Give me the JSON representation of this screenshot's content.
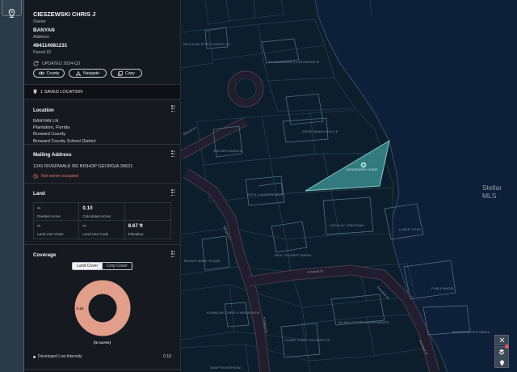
{
  "owner": {
    "name": "CIESZEWSKI CHRIS J",
    "name_label": "Owner"
  },
  "address": {
    "value": "BANYAN",
    "label": "Address"
  },
  "parcel": {
    "id": "494114081231",
    "label": "Parcel ID"
  },
  "updated": "UPDATED 2024-Q3",
  "actions": {
    "county": "County",
    "navigate": "Navigate",
    "copy": "Copy"
  },
  "saved": "1 SAVED LOCATION",
  "location": {
    "title": "Location",
    "lines": [
      "BANYAN LN",
      "Plantation, Florida",
      "Broward County",
      "Broward County School District"
    ]
  },
  "mailing": {
    "title": "Mailing Address",
    "address": "1241 RIVERWALK RD BISHOP GEORGIA 30621",
    "warning": "Not owner occupied"
  },
  "land": {
    "title": "Land",
    "cells": [
      {
        "value": "--",
        "label": "Deeded Acres"
      },
      {
        "value": "0.10",
        "label": "Calculated Acres"
      },
      {
        "value": "",
        "label": ""
      },
      {
        "value": "--",
        "label": "Land Use Class"
      },
      {
        "value": "--",
        "label": "Land Use Code"
      },
      {
        "value": "8.67 ft",
        "label": "Elevation"
      }
    ]
  },
  "coverage": {
    "title": "Coverage",
    "tabs": [
      "Land Cover",
      "Crop Cover"
    ],
    "units": "(in acres)",
    "legend": [
      {
        "name": "Developed Low Intensity",
        "value": "0.10"
      }
    ]
  },
  "chart_data": {
    "type": "pie",
    "labels": [
      "Developed Low Intensity"
    ],
    "values": [
      0.1
    ],
    "data_labels": [
      "0.10"
    ],
    "colors": [
      "#e19e8a"
    ]
  },
  "map": {
    "watermark": "Stellar MLS",
    "parcel_labels": [
      "CELLULAR STRUCTURES LLC",
      "SCHAUMBERG & CATHERINE M",
      "ZIEGELMANN KELLY E",
      "ROCHER ANGELA",
      "CIESZEWSKI CHRIS",
      "SETH J M BORROWER",
      "AZOULAY JONATHAN",
      "LUBER JOHN",
      "BISHOP MADE HJ AND",
      "NEAL TOLBERT MARIA",
      "PUBLE ANGEL",
      "KOWALSKI CHRIS H MENACHEM",
      "JALZIAL ESTATE INVESTMENTS",
      "ROJAS ESTHER MARIA",
      "CLAIRE STATE GEORGETTE",
      "KEMP RIVERFRONT"
    ],
    "road_labels": [
      "Banyan Ln",
      "Banyan Ln",
      "Kumquat Dr",
      "Kumquat Dr",
      "Kumquat Dr",
      "Kumquat Dr"
    ]
  },
  "colors": {
    "parcel_highlight": "#3a8f8f",
    "map_bg": "#0c1e2c",
    "water": "#0e1f3a",
    "donut": "#e19e8a"
  }
}
